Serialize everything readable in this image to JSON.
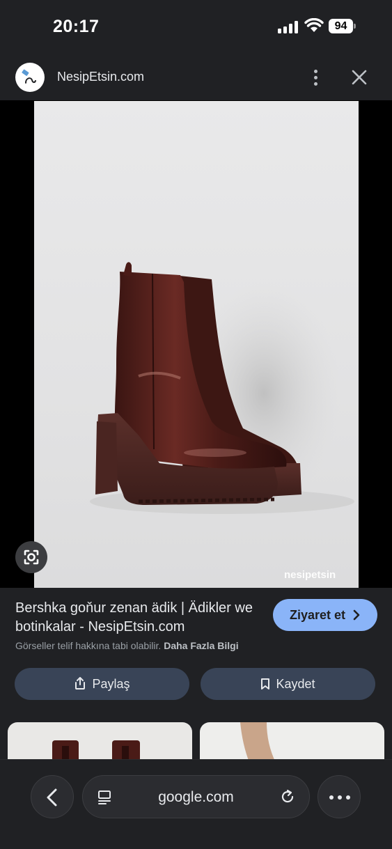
{
  "status_bar": {
    "time": "20:17",
    "battery": "94"
  },
  "header": {
    "site_name": "NesipEtsin.com"
  },
  "image": {
    "watermark": "nesipetsin"
  },
  "result": {
    "title": "Bershka goňur zenan ädik | Ädikler we botinkalar - NesipEtsin.com",
    "visit_label": "Ziyaret et",
    "copyright_text": "Görseller telif hakkına tabi olabilir.",
    "learn_more": "Daha Fazla Bilgi",
    "share_label": "Paylaş",
    "save_label": "Kaydet"
  },
  "bottom_bar": {
    "url": "google.com"
  }
}
